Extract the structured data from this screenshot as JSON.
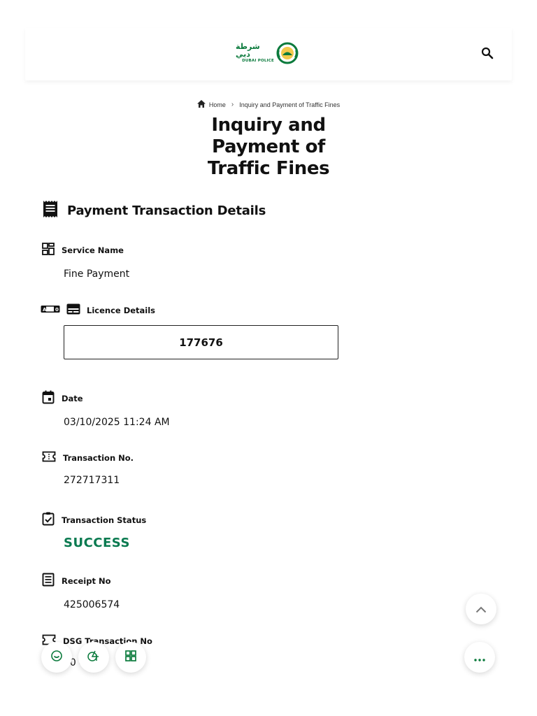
{
  "header": {
    "logo_arabic": "شرطة دبي",
    "logo_english": "DUBAI POLICE",
    "search_icon": "search-icon"
  },
  "breadcrumb": {
    "home": "Home",
    "current": "Inquiry and Payment of Traffic Fines"
  },
  "page": {
    "title_line1": "Inquiry and",
    "title_line2": "Payment of",
    "title_line3": "Traffic Fines"
  },
  "section": {
    "title": "Payment Transaction Details"
  },
  "fields": {
    "service_name_label": "Service Name",
    "service_name_value": "Fine Payment",
    "licence_label": "Licence Details",
    "licence_value": "177676",
    "date_label": "Date",
    "date_value": "03/10/2025 11:24 AM",
    "transaction_no_label": "Transaction No.",
    "transaction_no_value": "272717311",
    "status_label": "Transaction Status",
    "status_value": "SUCCESS",
    "receipt_label": "Receipt No",
    "receipt_value": "425006574",
    "dsg_label": "DSG Transaction No",
    "dsg_value": "00 47 55"
  },
  "colors": {
    "brand_green": "#0a7a3c",
    "success": "#0a7a50"
  }
}
